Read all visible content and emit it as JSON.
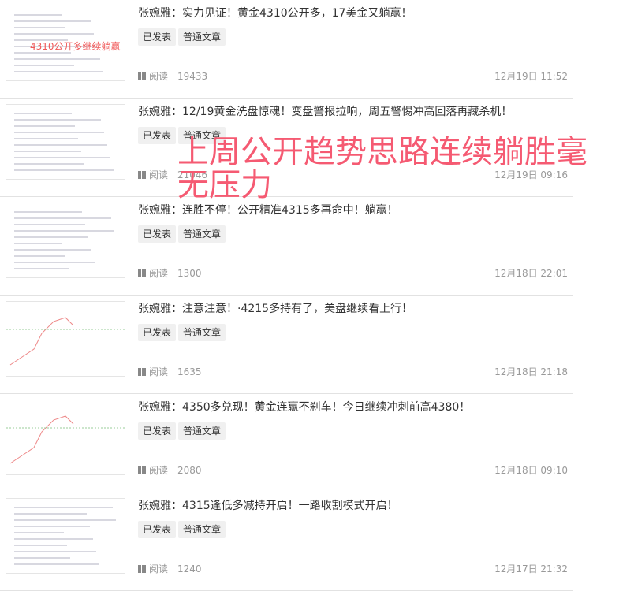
{
  "articles": [
    {
      "title": "张婉雅：实力见证！黄金4310公开多，17美金又躺赢！",
      "status": "已发表",
      "type": "普通文章",
      "read_label": "阅读",
      "reads": "19433",
      "date": "12月19日 11:52",
      "thumb_text": "4310公开多继续躺赢"
    },
    {
      "title": "张婉雅：12/19黄金洗盘惊魂！变盘警报拉响，周五警惕冲高回落再藏杀机！",
      "status": "已发表",
      "type": "普通文章",
      "read_label": "阅读",
      "reads": "21046",
      "date": "12月19日 09:16"
    },
    {
      "title": "张婉雅：连胜不停！公开精准4315多再命中！躺赢！",
      "status": "已发表",
      "type": "普通文章",
      "read_label": "阅读",
      "reads": "1300",
      "date": "12月18日 22:01"
    },
    {
      "title": "张婉雅：注意注意！·4215多持有了，美盘继续看上行！",
      "status": "已发表",
      "type": "普通文章",
      "read_label": "阅读",
      "reads": "1635",
      "date": "12月18日 21:18"
    },
    {
      "title": "张婉雅：4350多兑现！黄金连赢不刹车！今日继续冲刺前高4380！",
      "status": "已发表",
      "type": "普通文章",
      "read_label": "阅读",
      "reads": "2080",
      "date": "12月18日 09:10"
    },
    {
      "title": "张婉雅：4315逢低多减持开启！一路收割模式开启！",
      "status": "已发表",
      "type": "普通文章",
      "read_label": "阅读",
      "reads": "1240",
      "date": "12月17日 21:32"
    }
  ],
  "overlay_text": "上周公开趋势思路连续躺胜毫无压力",
  "colors": {
    "overlay": "#f55a72"
  }
}
